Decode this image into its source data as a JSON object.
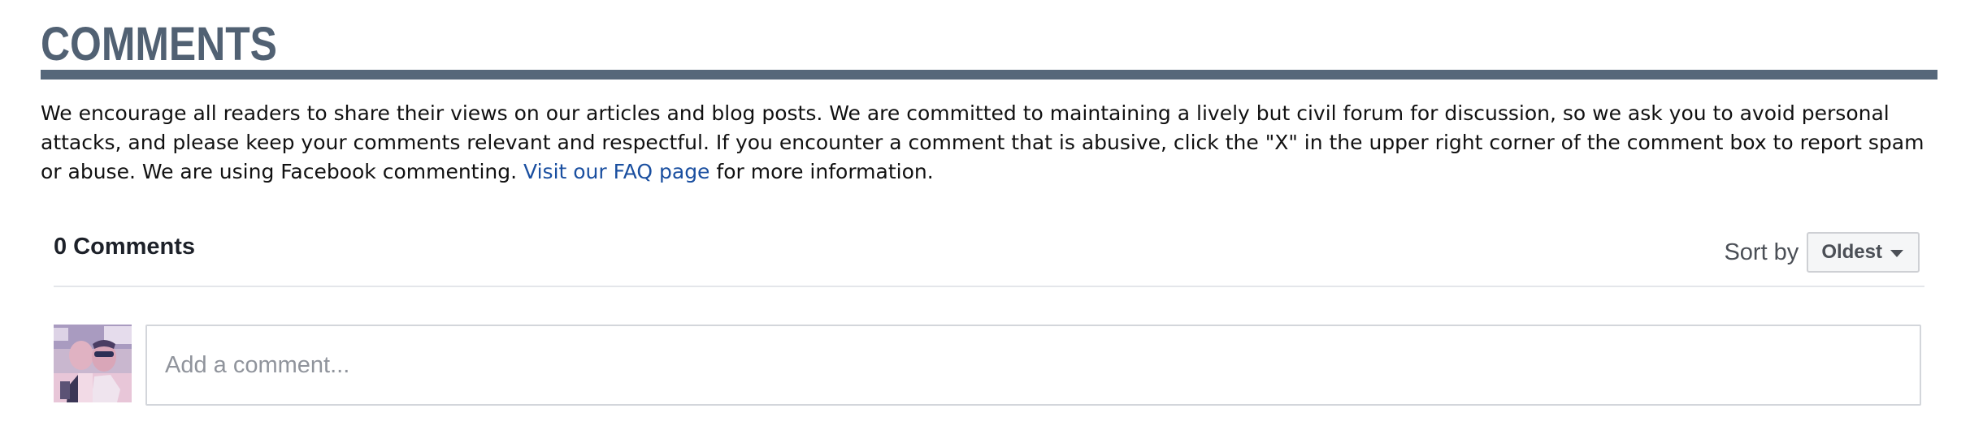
{
  "section": {
    "title": "COMMENTS"
  },
  "intro": {
    "text": "We encourage all readers to share their views on our articles and blog posts. We are committed to maintaining a lively but civil forum for discussion, so we ask you to avoid personal attacks, and please keep your comments relevant and respectful. If you encounter a comment that is abusive, click the \"X\" in the upper right corner of the comment box to report spam or abuse. We are using Facebook commenting.",
    "link_text": "Visit our FAQ page",
    "after_link": "for more information."
  },
  "comments": {
    "count_label": "0 Comments",
    "sort_label": "Sort by",
    "sort_value": "Oldest",
    "placeholder": "Add a comment...",
    "value": ""
  },
  "icons": {
    "sort_caret": "caret-down-icon"
  },
  "colors": {
    "title": "#516173",
    "rule": "#56677a",
    "link": "#1a4fa0"
  }
}
